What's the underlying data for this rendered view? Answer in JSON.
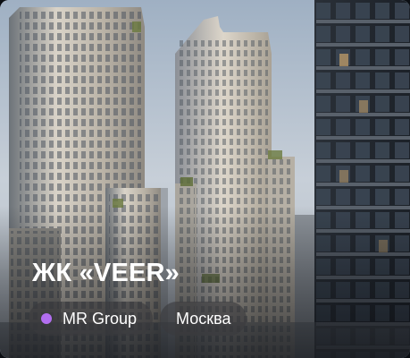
{
  "card": {
    "title": "ЖК «VEER»",
    "developer": {
      "label": "MR Group",
      "dot_color": "#b26ef0"
    },
    "city": {
      "label": "Москва"
    }
  },
  "colors": {
    "text": "#ffffff",
    "chip_background": "#3a3a3e"
  }
}
